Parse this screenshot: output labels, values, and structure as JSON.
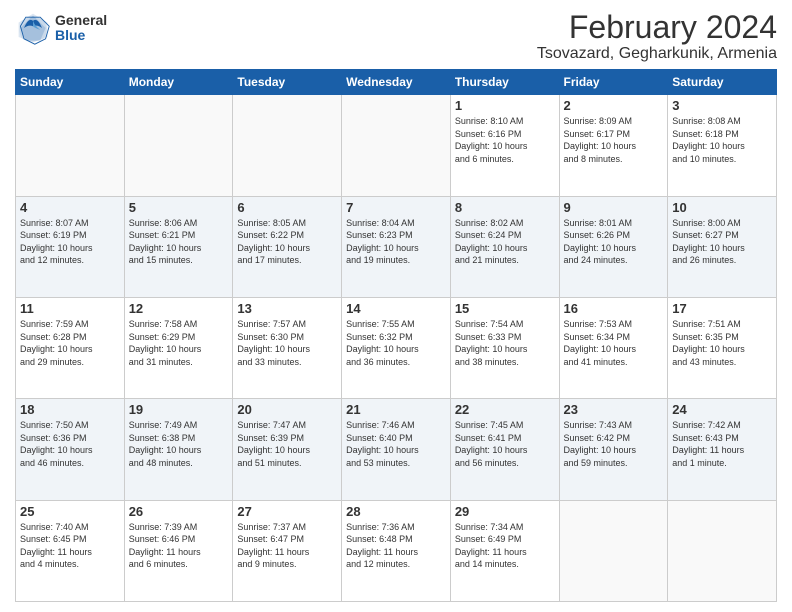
{
  "header": {
    "logo_general": "General",
    "logo_blue": "Blue",
    "month_title": "February 2024",
    "location": "Tsovazard, Gegharkunik, Armenia"
  },
  "weekdays": [
    "Sunday",
    "Monday",
    "Tuesday",
    "Wednesday",
    "Thursday",
    "Friday",
    "Saturday"
  ],
  "weeks": [
    [
      {
        "day": "",
        "info": ""
      },
      {
        "day": "",
        "info": ""
      },
      {
        "day": "",
        "info": ""
      },
      {
        "day": "",
        "info": ""
      },
      {
        "day": "1",
        "info": "Sunrise: 8:10 AM\nSunset: 6:16 PM\nDaylight: 10 hours\nand 6 minutes."
      },
      {
        "day": "2",
        "info": "Sunrise: 8:09 AM\nSunset: 6:17 PM\nDaylight: 10 hours\nand 8 minutes."
      },
      {
        "day": "3",
        "info": "Sunrise: 8:08 AM\nSunset: 6:18 PM\nDaylight: 10 hours\nand 10 minutes."
      }
    ],
    [
      {
        "day": "4",
        "info": "Sunrise: 8:07 AM\nSunset: 6:19 PM\nDaylight: 10 hours\nand 12 minutes."
      },
      {
        "day": "5",
        "info": "Sunrise: 8:06 AM\nSunset: 6:21 PM\nDaylight: 10 hours\nand 15 minutes."
      },
      {
        "day": "6",
        "info": "Sunrise: 8:05 AM\nSunset: 6:22 PM\nDaylight: 10 hours\nand 17 minutes."
      },
      {
        "day": "7",
        "info": "Sunrise: 8:04 AM\nSunset: 6:23 PM\nDaylight: 10 hours\nand 19 minutes."
      },
      {
        "day": "8",
        "info": "Sunrise: 8:02 AM\nSunset: 6:24 PM\nDaylight: 10 hours\nand 21 minutes."
      },
      {
        "day": "9",
        "info": "Sunrise: 8:01 AM\nSunset: 6:26 PM\nDaylight: 10 hours\nand 24 minutes."
      },
      {
        "day": "10",
        "info": "Sunrise: 8:00 AM\nSunset: 6:27 PM\nDaylight: 10 hours\nand 26 minutes."
      }
    ],
    [
      {
        "day": "11",
        "info": "Sunrise: 7:59 AM\nSunset: 6:28 PM\nDaylight: 10 hours\nand 29 minutes."
      },
      {
        "day": "12",
        "info": "Sunrise: 7:58 AM\nSunset: 6:29 PM\nDaylight: 10 hours\nand 31 minutes."
      },
      {
        "day": "13",
        "info": "Sunrise: 7:57 AM\nSunset: 6:30 PM\nDaylight: 10 hours\nand 33 minutes."
      },
      {
        "day": "14",
        "info": "Sunrise: 7:55 AM\nSunset: 6:32 PM\nDaylight: 10 hours\nand 36 minutes."
      },
      {
        "day": "15",
        "info": "Sunrise: 7:54 AM\nSunset: 6:33 PM\nDaylight: 10 hours\nand 38 minutes."
      },
      {
        "day": "16",
        "info": "Sunrise: 7:53 AM\nSunset: 6:34 PM\nDaylight: 10 hours\nand 41 minutes."
      },
      {
        "day": "17",
        "info": "Sunrise: 7:51 AM\nSunset: 6:35 PM\nDaylight: 10 hours\nand 43 minutes."
      }
    ],
    [
      {
        "day": "18",
        "info": "Sunrise: 7:50 AM\nSunset: 6:36 PM\nDaylight: 10 hours\nand 46 minutes."
      },
      {
        "day": "19",
        "info": "Sunrise: 7:49 AM\nSunset: 6:38 PM\nDaylight: 10 hours\nand 48 minutes."
      },
      {
        "day": "20",
        "info": "Sunrise: 7:47 AM\nSunset: 6:39 PM\nDaylight: 10 hours\nand 51 minutes."
      },
      {
        "day": "21",
        "info": "Sunrise: 7:46 AM\nSunset: 6:40 PM\nDaylight: 10 hours\nand 53 minutes."
      },
      {
        "day": "22",
        "info": "Sunrise: 7:45 AM\nSunset: 6:41 PM\nDaylight: 10 hours\nand 56 minutes."
      },
      {
        "day": "23",
        "info": "Sunrise: 7:43 AM\nSunset: 6:42 PM\nDaylight: 10 hours\nand 59 minutes."
      },
      {
        "day": "24",
        "info": "Sunrise: 7:42 AM\nSunset: 6:43 PM\nDaylight: 11 hours\nand 1 minute."
      }
    ],
    [
      {
        "day": "25",
        "info": "Sunrise: 7:40 AM\nSunset: 6:45 PM\nDaylight: 11 hours\nand 4 minutes."
      },
      {
        "day": "26",
        "info": "Sunrise: 7:39 AM\nSunset: 6:46 PM\nDaylight: 11 hours\nand 6 minutes."
      },
      {
        "day": "27",
        "info": "Sunrise: 7:37 AM\nSunset: 6:47 PM\nDaylight: 11 hours\nand 9 minutes."
      },
      {
        "day": "28",
        "info": "Sunrise: 7:36 AM\nSunset: 6:48 PM\nDaylight: 11 hours\nand 12 minutes."
      },
      {
        "day": "29",
        "info": "Sunrise: 7:34 AM\nSunset: 6:49 PM\nDaylight: 11 hours\nand 14 minutes."
      },
      {
        "day": "",
        "info": ""
      },
      {
        "day": "",
        "info": ""
      }
    ]
  ]
}
